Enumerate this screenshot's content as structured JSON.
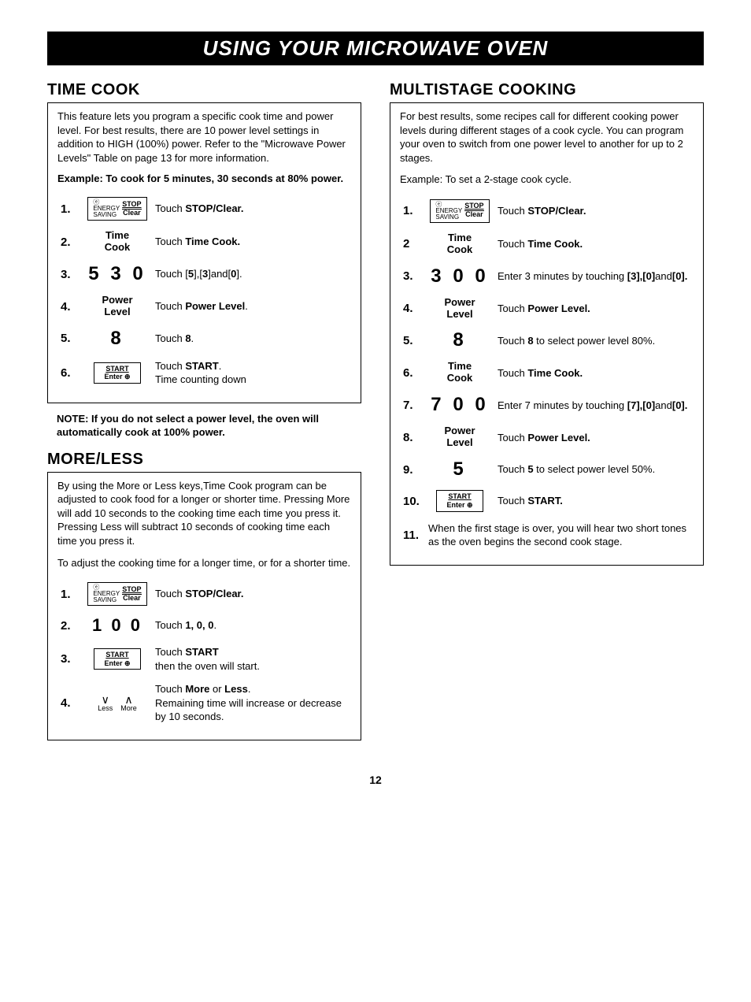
{
  "banner": "USING YOUR MICROWAVE OVEN",
  "page_number": "12",
  "left": {
    "timecook": {
      "title": "TIME COOK",
      "intro": "This feature lets you program a specific cook time and power level. For best results, there are 10 power level settings in addition to HIGH (100%) power. Refer to the \"Microwave Power Levels\" Table on page 13 for more information.",
      "example": "Example: To cook for 5 minutes, 30 seconds at 80% power.",
      "steps": [
        {
          "n": "1.",
          "icon": "stopclear",
          "desc": "Touch <b>STOP/Clear.</b>"
        },
        {
          "n": "2.",
          "icon": "timecook",
          "desc": "Touch <b>Time Cook.</b>"
        },
        {
          "n": "3.",
          "icon": "530",
          "desc": "Touch [<b>5</b>],[<b>3</b>]and[<b>0</b>]."
        },
        {
          "n": "4.",
          "icon": "powerlevel",
          "desc": "Touch <b>Power Level</b>."
        },
        {
          "n": "5.",
          "icon": "8",
          "desc": "Touch <b>8</b>."
        },
        {
          "n": "6.",
          "icon": "start",
          "desc": "Touch <b>START</b>.<br>Time counting down"
        }
      ],
      "note": "NOTE: If you do not select a power level, the oven will automatically cook at 100% power."
    },
    "moreless": {
      "title": "MORE/LESS",
      "intro": "By using the More or Less keys,Time Cook program can be adjusted to cook food for a longer or shorter time. Pressing More will add 10 seconds to the cooking time each time you press it. Pressing Less will subtract 10 seconds of cooking time each time you press it.",
      "sub": "To adjust the cooking time for a longer time, or for a shorter time.",
      "steps": [
        {
          "n": "1.",
          "icon": "stopclear",
          "desc": "Touch <b>STOP/Clear.</b>"
        },
        {
          "n": "2.",
          "icon": "100",
          "desc": "Touch <b>1, 0, 0</b>."
        },
        {
          "n": "3.",
          "icon": "start",
          "desc": "Touch <b>START</b><br>then the oven will start."
        },
        {
          "n": "4.",
          "icon": "lessmore",
          "desc": "Touch <b>More</b> or <b>Less</b>.<br>Remaining time will increase or decrease by 10 seconds."
        }
      ]
    }
  },
  "right": {
    "multistage": {
      "title": "MULTISTAGE COOKING",
      "intro": "For best results, some recipes call for different cooking power levels during different stages of a cook cycle. You can program your oven to switch from one power level to another for up to 2 stages.",
      "example": "Example: To set a 2-stage cook cycle.",
      "steps": [
        {
          "n": "1.",
          "icon": "stopclear",
          "desc": "Touch <b>STOP/Clear.</b>"
        },
        {
          "n": "2",
          "icon": "timecook",
          "desc": "Touch <b>Time Cook.</b>"
        },
        {
          "n": "3.",
          "icon": "300",
          "desc": "Enter 3 minutes by touching <b>[3],[0]</b>and<b>[0].</b>"
        },
        {
          "n": "4.",
          "icon": "powerlevel",
          "desc": "Touch <b>Power Level.</b>"
        },
        {
          "n": "5.",
          "icon": "8",
          "desc": "Touch <b>8</b> to select power level 80%."
        },
        {
          "n": "6.",
          "icon": "timecook",
          "desc": "Touch <b>Time Cook.</b>"
        },
        {
          "n": "7.",
          "icon": "700",
          "desc": "Enter 7 minutes by touching <b>[7],[0]</b>and<b>[0].</b>"
        },
        {
          "n": "8.",
          "icon": "powerlevel",
          "desc": "Touch <b>Power Level.</b>"
        },
        {
          "n": "9.",
          "icon": "5",
          "desc": "Touch <b>5</b> to select power level 50%."
        },
        {
          "n": "10.",
          "icon": "start",
          "desc": "Touch <b>START.</b>"
        }
      ],
      "final_n": "11.",
      "final": "When the first stage is over, you will hear two short tones as the oven begins the second cook stage."
    }
  },
  "labels": {
    "stop": "STOP",
    "clear": "Clear",
    "start": "START",
    "enter": "Enter ⊕",
    "energy": "ENERGY\nSAVING",
    "timecook": "Time\nCook",
    "powerlevel": "Power\nLevel",
    "less": "Less",
    "more": "More",
    "d530": "5 3 0",
    "d300": "3 0 0",
    "d700": "7 0 0",
    "d100": "1 0 0",
    "d8": "8",
    "d5": "5"
  }
}
